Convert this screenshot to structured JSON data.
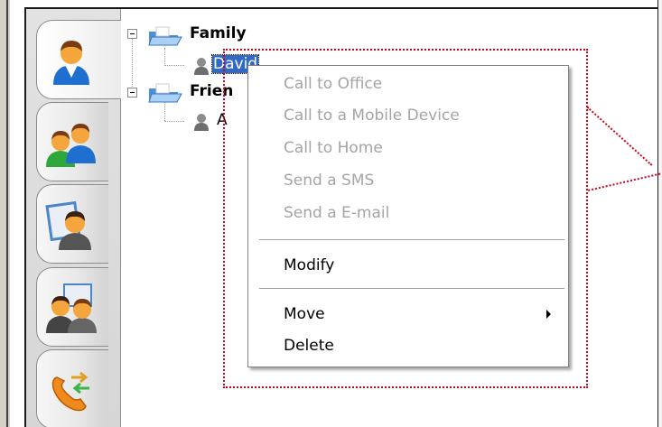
{
  "sidebar": {
    "tabs": [
      {
        "icon": "contact-person-icon",
        "selected": true
      },
      {
        "icon": "contact-group-icon",
        "selected": false
      },
      {
        "icon": "address-book-icon",
        "selected": false
      },
      {
        "icon": "shared-contacts-icon",
        "selected": false
      },
      {
        "icon": "call-transfer-icon",
        "selected": false
      }
    ]
  },
  "tree": {
    "groups": [
      {
        "label": "Family",
        "icon": "folder-icon",
        "expanded": true,
        "children": [
          {
            "label": "David",
            "icon": "contact-icon",
            "selected": true
          }
        ]
      },
      {
        "label": "Frien",
        "icon": "folder-icon",
        "expanded": true,
        "children": [
          {
            "label": "A",
            "icon": "contact-icon",
            "selected": false
          }
        ]
      }
    ]
  },
  "context_menu": {
    "items": [
      {
        "label": "Call to Office",
        "disabled": true
      },
      {
        "label": "Call to a Mobile Device",
        "disabled": true
      },
      {
        "label": "Call to Home",
        "disabled": true
      },
      {
        "label": "Send a SMS",
        "disabled": true
      },
      {
        "label": "Send a E-mail",
        "disabled": true
      },
      {
        "label": "Modify",
        "disabled": false
      },
      {
        "label": "Move",
        "disabled": false,
        "submenu_arrow": "submenu-arrow-icon"
      },
      {
        "label": "Delete",
        "disabled": false
      }
    ]
  },
  "colors": {
    "selection": "#316ac5",
    "disabled_text": "#a4a4a4",
    "highlight_outline": "#d0021b"
  }
}
